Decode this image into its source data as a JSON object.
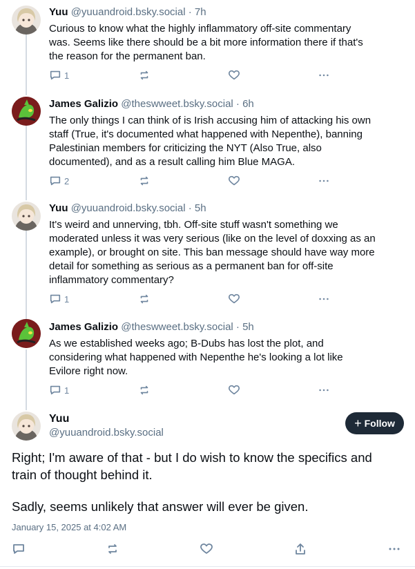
{
  "replies": [
    {
      "name": "Yuu",
      "handle": "@yuuandroid.bsky.social",
      "time": "· 7h",
      "lines": [
        "Curious to know what the highly inflammatory off-site commentary",
        "was. Seems like there should be a bit more information there if that's",
        "the reason for the permanent ban."
      ],
      "reply_count": "1"
    },
    {
      "name": "James Galizio",
      "handle": "@theswweet.bsky.social",
      "time": "· 6h",
      "lines": [
        "The only things I can think of is Irish accusing him of attacking his own",
        "staff (True, it's documented what happened with Nepenthe), banning",
        "Palestinian members for criticizing the NYT (Also True, also",
        "documented), and as a result calling him Blue MAGA."
      ],
      "reply_count": "2"
    },
    {
      "name": "Yuu",
      "handle": "@yuuandroid.bsky.social",
      "time": "· 5h",
      "lines": [
        "It's weird and unnerving, tbh. Off-site stuff wasn't something we",
        "moderated unless it was very serious (like on the level of doxxing as an",
        "example), or brought on site. This ban message should have way more",
        "detail for something as serious as a permanent ban for off-site",
        "inflammatory commentary?"
      ],
      "reply_count": "1"
    },
    {
      "name": "James Galizio",
      "handle": "@theswweet.bsky.social",
      "time": "· 5h",
      "lines": [
        "As we established weeks ago; B-Dubs has lost the plot, and",
        "considering what happened with Nepenthe he's looking a lot like",
        "Evilore right now."
      ],
      "reply_count": "1"
    }
  ],
  "main_post": {
    "name": "Yuu",
    "handle": "@yuuandroid.bsky.social",
    "follow_label": "Follow",
    "lines": [
      "Right; I'm aware of that - but I do wish to know the specifics and",
      "train of thought behind it.",
      "",
      "Sadly, seems unlikely that answer will ever be given."
    ],
    "date": "January 15, 2025 at 4:02 AM"
  },
  "icons": {
    "reply": "speech-bubble-icon",
    "repost": "repost-arrows-icon",
    "like": "heart-icon",
    "more": "ellipsis-icon",
    "share": "share-up-icon",
    "follow": "plus-icon"
  },
  "colors": {
    "follow_button": "#1e2a37",
    "action_icon": "#6f869f",
    "handle_text": "#5a6f83",
    "thread_line": "#d4dbe2"
  }
}
